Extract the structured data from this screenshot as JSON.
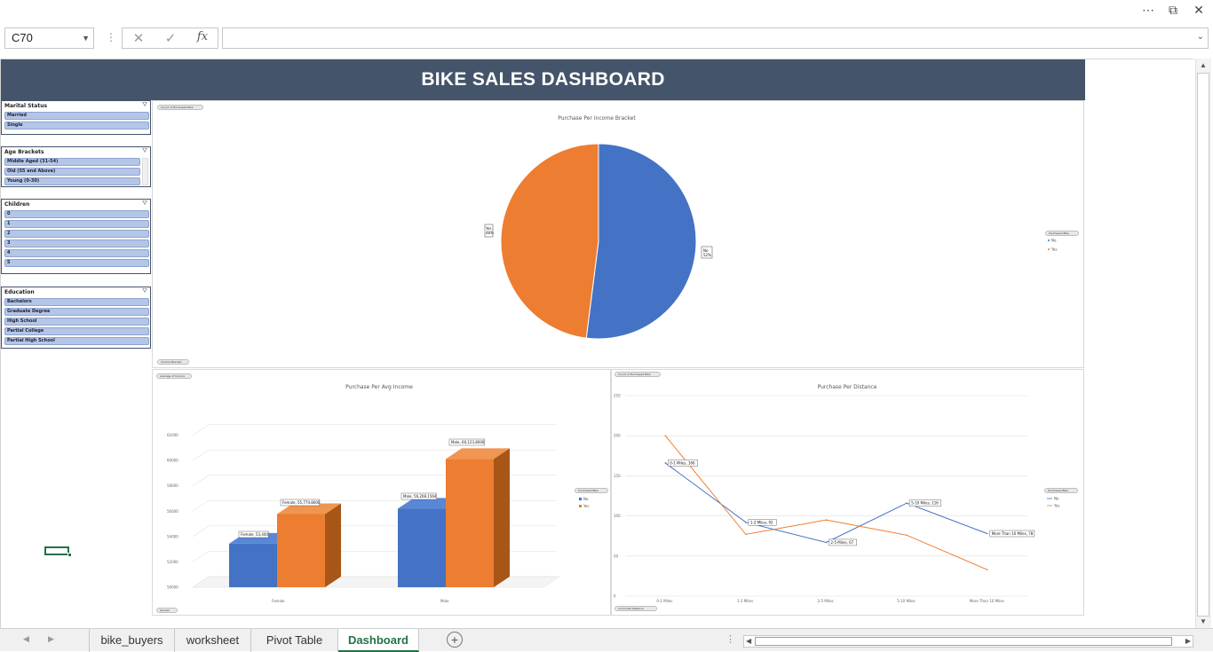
{
  "window": {
    "more_icon": "⋯",
    "restore_icon": "⧉",
    "close_icon": "✕"
  },
  "formula_bar": {
    "name_box": "C70",
    "formula_value": ""
  },
  "dashboard": {
    "title": "BIKE SALES DASHBOARD"
  },
  "slicers": [
    {
      "title": "Marital Status",
      "items": [
        "Married",
        "Single"
      ]
    },
    {
      "title": "Age Brackets",
      "items": [
        "Middle Aged (31-54)",
        "Old (55 and Above)",
        "Young (0-30)"
      ]
    },
    {
      "title": "Children",
      "items": [
        "0",
        "1",
        "2",
        "3",
        "4",
        "5"
      ]
    },
    {
      "title": "Education",
      "items": [
        "Bachelors",
        "Graduate Degree",
        "High School",
        "Partial College",
        "Partial High School"
      ]
    }
  ],
  "charts": {
    "pie": {
      "title": "Purchase Per Income Bracket",
      "field_top": "Count of Purchased Bike",
      "field_bottom": "Income Bracket",
      "legend_title": "Purchased Bike",
      "legend": [
        "No",
        "Yes"
      ],
      "label_no": "No",
      "label_no_value": "52%",
      "label_yes": "Yes",
      "label_yes_value": "48%"
    },
    "bar": {
      "title": "Purchase Per Avg Income",
      "field_top": "Average of Income",
      "field_bottom": "Gender",
      "legend_title": "Purchased Bike",
      "legend": [
        "No",
        "Yes"
      ],
      "labels": [
        "Female, 53,440",
        "Female, 55,774.8000",
        "Male, 56,208.1564",
        "Male, 60,123.8000"
      ]
    },
    "line": {
      "title": "Purchase Per Distance",
      "field_top": "Count of Purchased Bike",
      "field_bottom": "Commute Distance",
      "legend_title": "Purchased Bike",
      "legend": [
        "No",
        "Yes"
      ],
      "labels": [
        "0-1 Miles, 166",
        "1-2 Miles, 92",
        "2-5 Miles, 67",
        "5-10 Miles, 116",
        "More Than 10 Miles, 78"
      ]
    }
  },
  "chart_data": [
    {
      "type": "pie",
      "title": "Purchase Per Income Bracket",
      "categories": [
        "No",
        "Yes"
      ],
      "values": [
        52,
        48
      ],
      "legend": "right"
    },
    {
      "type": "bar",
      "title": "Purchase Per Avg Income",
      "categories": [
        "Female",
        "Male"
      ],
      "series": [
        {
          "name": "No",
          "values": [
            53440,
            56208
          ]
        },
        {
          "name": "Yes",
          "values": [
            55775,
            60124
          ]
        }
      ],
      "ylim": [
        50000,
        64000
      ],
      "yticks": [
        "50000",
        "52000",
        "54000",
        "56000",
        "58000",
        "60000",
        "62000"
      ],
      "grid": true,
      "legend": "right"
    },
    {
      "type": "line",
      "title": "Purchase Per Distance",
      "categories": [
        "0-1 Miles",
        "1-2 Miles",
        "2-5 Miles",
        "5-10 Miles",
        "More Than 10 Miles"
      ],
      "series": [
        {
          "name": "No",
          "values": [
            166,
            92,
            67,
            116,
            78
          ]
        },
        {
          "name": "Yes",
          "values": [
            200,
            77,
            95,
            76,
            33
          ]
        }
      ],
      "ylim": [
        0,
        250
      ],
      "yticks": [
        "0",
        "50",
        "100",
        "150",
        "200",
        "250"
      ],
      "grid": true,
      "legend": "right"
    }
  ],
  "colors": {
    "no": "#4472c4",
    "yes": "#ed7d31",
    "banner": "#44546a",
    "excel_green": "#217346"
  },
  "sheet_tabs": {
    "tabs": [
      "bike_buyers",
      "worksheet",
      "Pivot Table",
      "Dashboard"
    ],
    "active": "Dashboard"
  }
}
